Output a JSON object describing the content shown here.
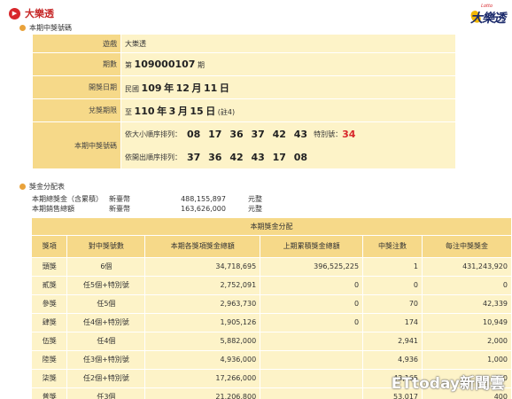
{
  "header": {
    "title": "大樂透",
    "logo_text": "大樂透",
    "logo_sup": "Lotto"
  },
  "section1": {
    "title": "本期中獎號碼",
    "period_label": "期數",
    "game_label": "遊戲",
    "game_value": "大樂透",
    "period_prefix": "第",
    "period_num": "109000107",
    "period_suffix": "期",
    "date_label": "開獎日期",
    "date_prefix": "民國",
    "date_year": "109",
    "date_year_u": "年",
    "date_month": "12",
    "date_month_u": "月",
    "date_day": "11",
    "date_day_u": "日",
    "deadline_label": "兌獎期限",
    "deadline_prefix": "至",
    "deadline_year": "110",
    "deadline_year_u": "年",
    "deadline_month": "3",
    "deadline_month_u": "月",
    "deadline_day": "15",
    "deadline_day_u": "日",
    "deadline_note": "(註4)",
    "numbers_label": "本期中獎號碼",
    "sorted_label": "依大小順序排列：",
    "sorted_numbers": [
      "08",
      "17",
      "36",
      "37",
      "42",
      "43"
    ],
    "special_label": "特別號：",
    "special_number": "34",
    "draw_label": "依開出順序排列：",
    "draw_numbers": [
      "37",
      "36",
      "42",
      "43",
      "17",
      "08"
    ]
  },
  "section2": {
    "title": "獎金分配表",
    "total_label": "本期總獎金（含累積）",
    "total_currency": "新臺幣",
    "total_value": "488,155,897",
    "total_unit": "元整",
    "sales_label": "本期銷售總額",
    "sales_currency": "新臺幣",
    "sales_value": "163,626,000",
    "sales_unit": "元整"
  },
  "prize_table": {
    "caption": "本期獎金分配",
    "headers": [
      "獎項",
      "對中獎號數",
      "本期各獎項獎金總額",
      "上期累積獎金總額",
      "中獎注數",
      "每注中獎獎金"
    ],
    "rows": [
      [
        "頭獎",
        "6個",
        "34,718,695",
        "396,525,225",
        "1",
        "431,243,920"
      ],
      [
        "貳獎",
        "任5個+特別號",
        "2,752,091",
        "0",
        "0",
        "0"
      ],
      [
        "參獎",
        "任5個",
        "2,963,730",
        "0",
        "70",
        "42,339"
      ],
      [
        "肆獎",
        "任4個+特別號",
        "1,905,126",
        "0",
        "174",
        "10,949"
      ],
      [
        "伍獎",
        "任4個",
        "5,882,000",
        "",
        "2,941",
        "2,000"
      ],
      [
        "陸獎",
        "任3個+特別號",
        "4,936,000",
        "",
        "4,936",
        "1,000"
      ],
      [
        "柒獎",
        "任2個+特別號",
        "17,266,000",
        "",
        "43,165",
        "400"
      ],
      [
        "普獎",
        "任3個",
        "21,206,800",
        "",
        "53,017",
        "400"
      ]
    ]
  },
  "watermark": "ETtoday新聞雲",
  "colors": {
    "label_bg": "#f6d989",
    "value_bg": "#fdf3c8",
    "accent_red": "#d8262b"
  }
}
